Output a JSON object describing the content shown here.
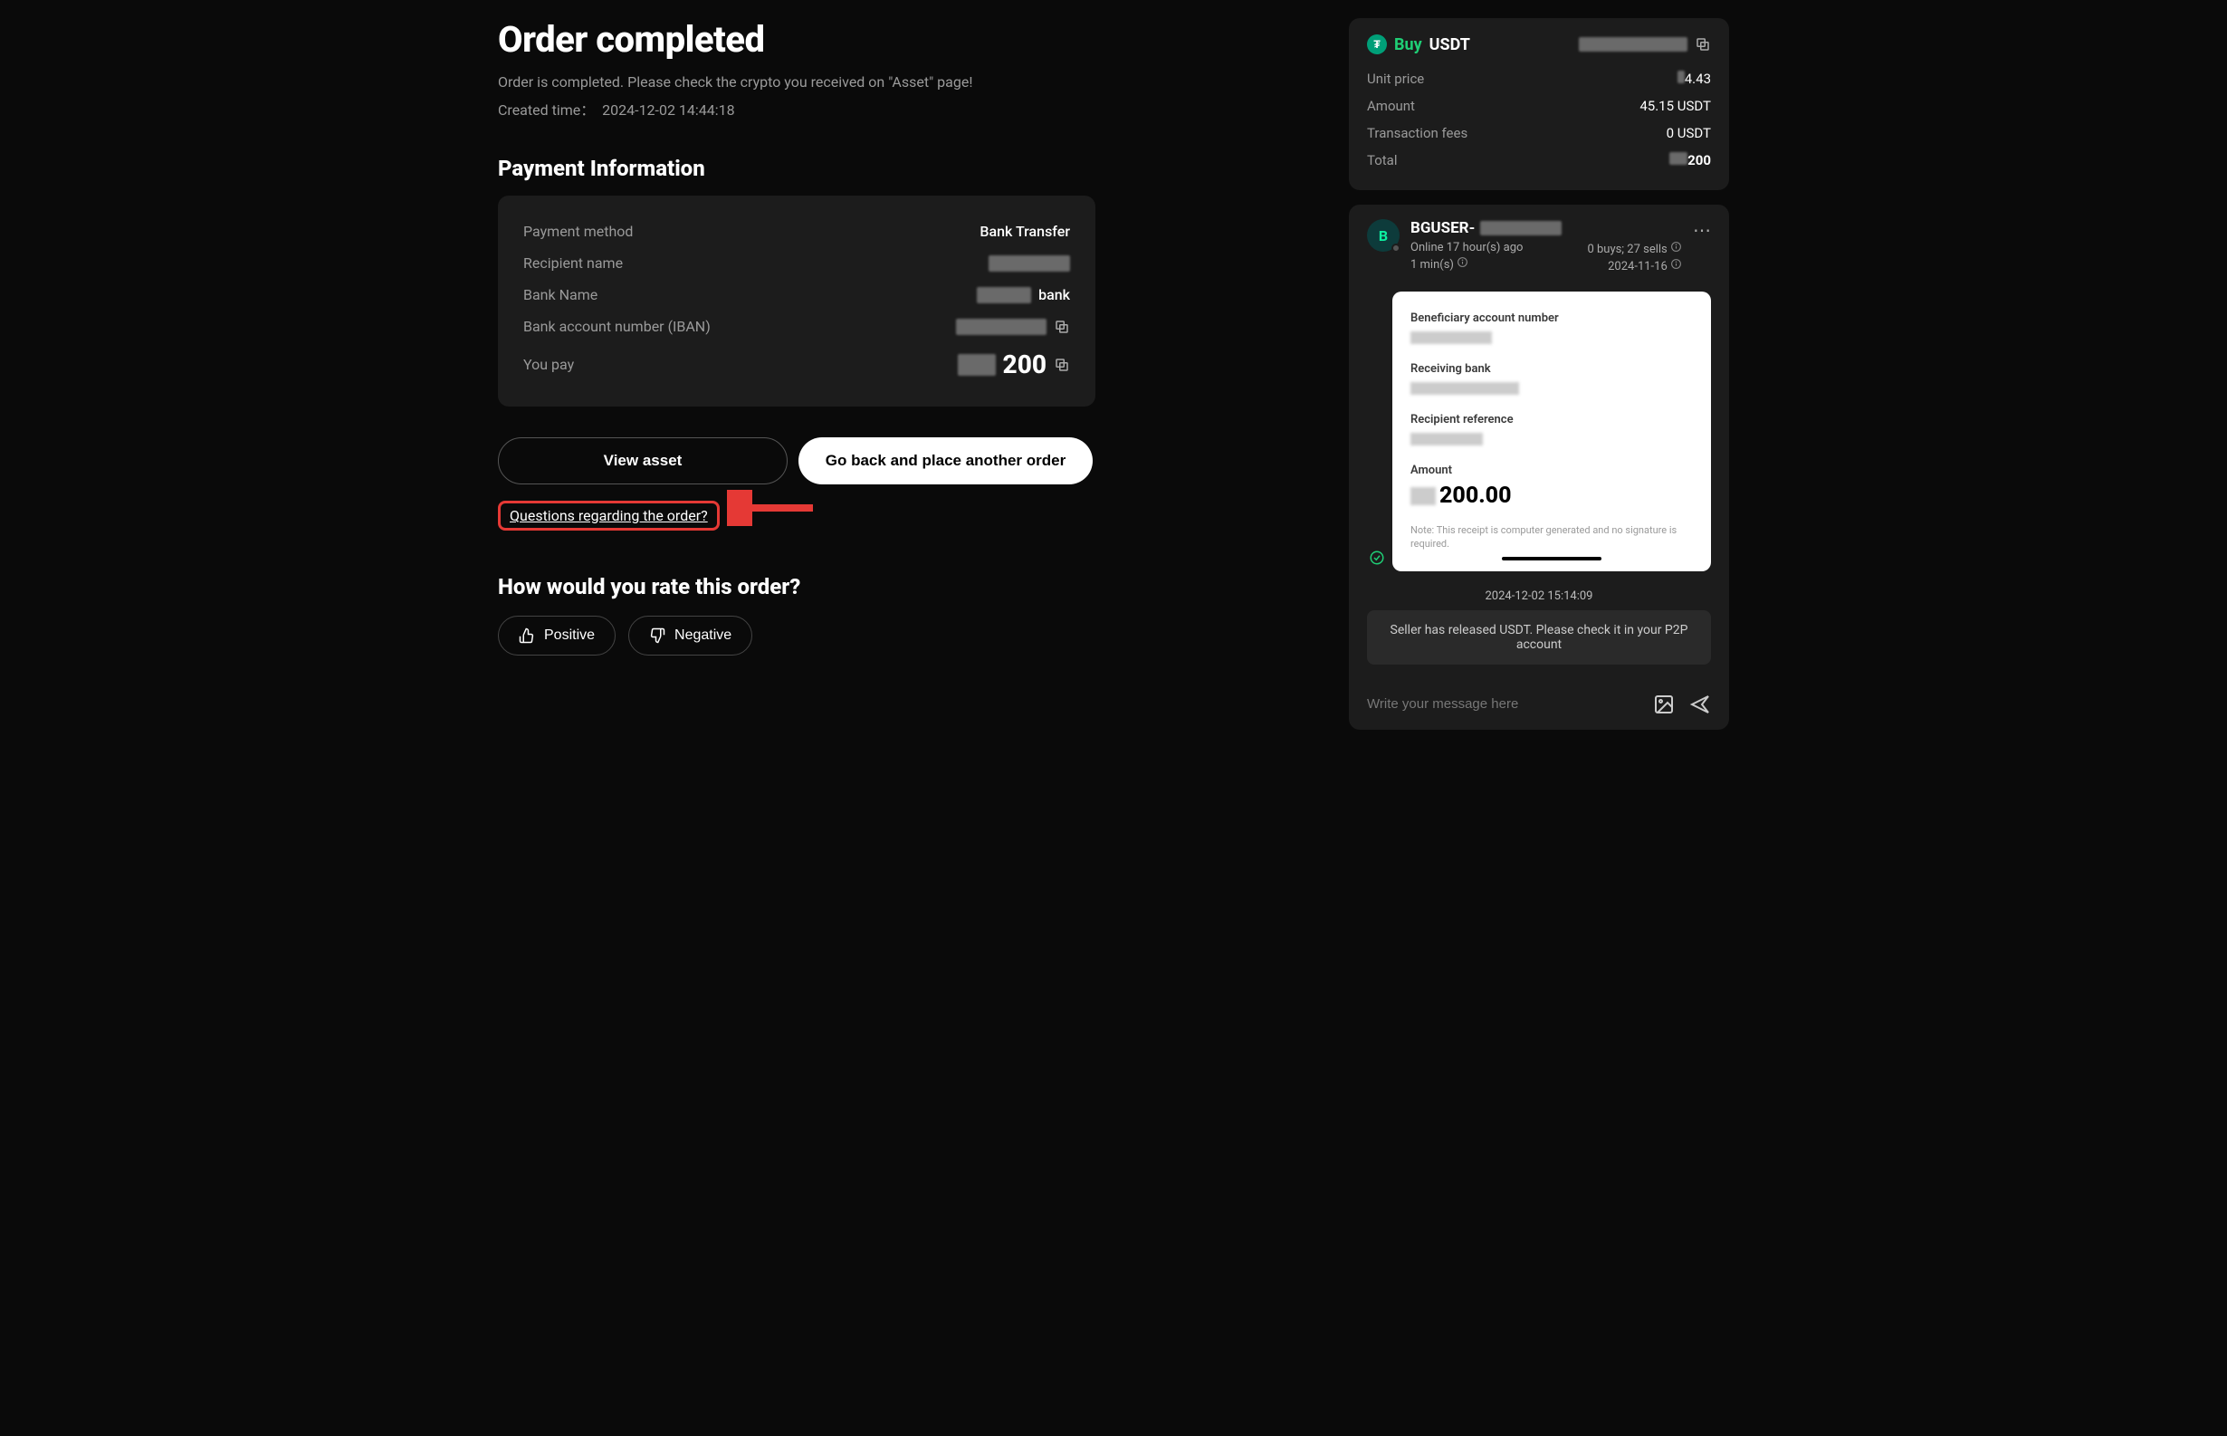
{
  "header": {
    "title": "Order completed",
    "subtitle": "Order is completed. Please check the crypto you received on \"Asset\" page!",
    "created_label": "Created time：",
    "created_time": "2024-12-02 14:44:18"
  },
  "payment": {
    "heading": "Payment Information",
    "rows": {
      "method": {
        "label": "Payment method",
        "value": "Bank Transfer"
      },
      "recipient": {
        "label": "Recipient name"
      },
      "bank": {
        "label": "Bank Name",
        "suffix": "bank"
      },
      "iban": {
        "label": "Bank account number (IBAN)"
      },
      "pay": {
        "label": "You pay",
        "value": "200"
      }
    }
  },
  "actions": {
    "view_asset": "View asset",
    "go_back": "Go back and place another order",
    "questions": "Questions regarding the order?"
  },
  "rating": {
    "heading": "How would you rate this order?",
    "positive": "Positive",
    "negative": "Negative"
  },
  "summary": {
    "side": "Buy",
    "asset": "USDT",
    "rows": {
      "unit": {
        "label": "Unit price",
        "value": "4.43"
      },
      "amount": {
        "label": "Amount",
        "value": "45.15 USDT"
      },
      "fees": {
        "label": "Transaction fees",
        "value": "0 USDT"
      },
      "total": {
        "label": "Total",
        "value": "200"
      }
    }
  },
  "chat": {
    "avatar_initial": "B",
    "username_prefix": "BGUSER-",
    "online": "Online 17 hour(s) ago",
    "duration": "1 min(s)",
    "stats": "0 buys; 27 sells",
    "date": "2024-11-16",
    "receipt": {
      "benef_label": "Beneficiary account number",
      "bank_label": "Receiving bank",
      "ref_label": "Recipient reference",
      "amount_label": "Amount",
      "amount_value": "200.00",
      "note": "Note: This receipt is computer generated and no signature is required."
    },
    "timestamp": "2024-12-02 15:14:09",
    "system_msg": "Seller has released USDT. Please check it in your P2P account",
    "placeholder": "Write your message here"
  }
}
